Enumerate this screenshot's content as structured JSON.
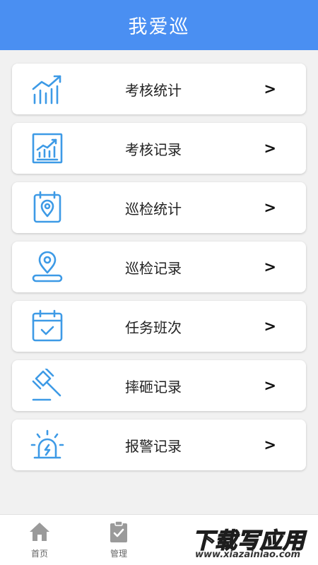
{
  "header": {
    "title": "我爱巡"
  },
  "colors": {
    "brand": "#4a8ff2",
    "icon_blue": "#3d9ae6"
  },
  "menu": [
    {
      "label": "考核统计",
      "icon": "bar-chart-trend-icon",
      "arrow": ">"
    },
    {
      "label": "考核记录",
      "icon": "report-chart-icon",
      "arrow": ">"
    },
    {
      "label": "巡检统计",
      "icon": "calendar-location-icon",
      "arrow": ">"
    },
    {
      "label": "巡检记录",
      "icon": "map-pin-icon",
      "arrow": ">"
    },
    {
      "label": "任务班次",
      "icon": "calendar-check-icon",
      "arrow": ">"
    },
    {
      "label": "摔砸记录",
      "icon": "gavel-icon",
      "arrow": ">"
    },
    {
      "label": "报警记录",
      "icon": "alarm-light-icon",
      "arrow": ">"
    }
  ],
  "tabbar": {
    "tabs": [
      {
        "label": "首页",
        "icon": "home-icon"
      },
      {
        "label": "管理",
        "icon": "clipboard-check-icon"
      }
    ]
  },
  "watermark": {
    "text": "下载写应用",
    "url": "www.xiazainiao.com"
  }
}
